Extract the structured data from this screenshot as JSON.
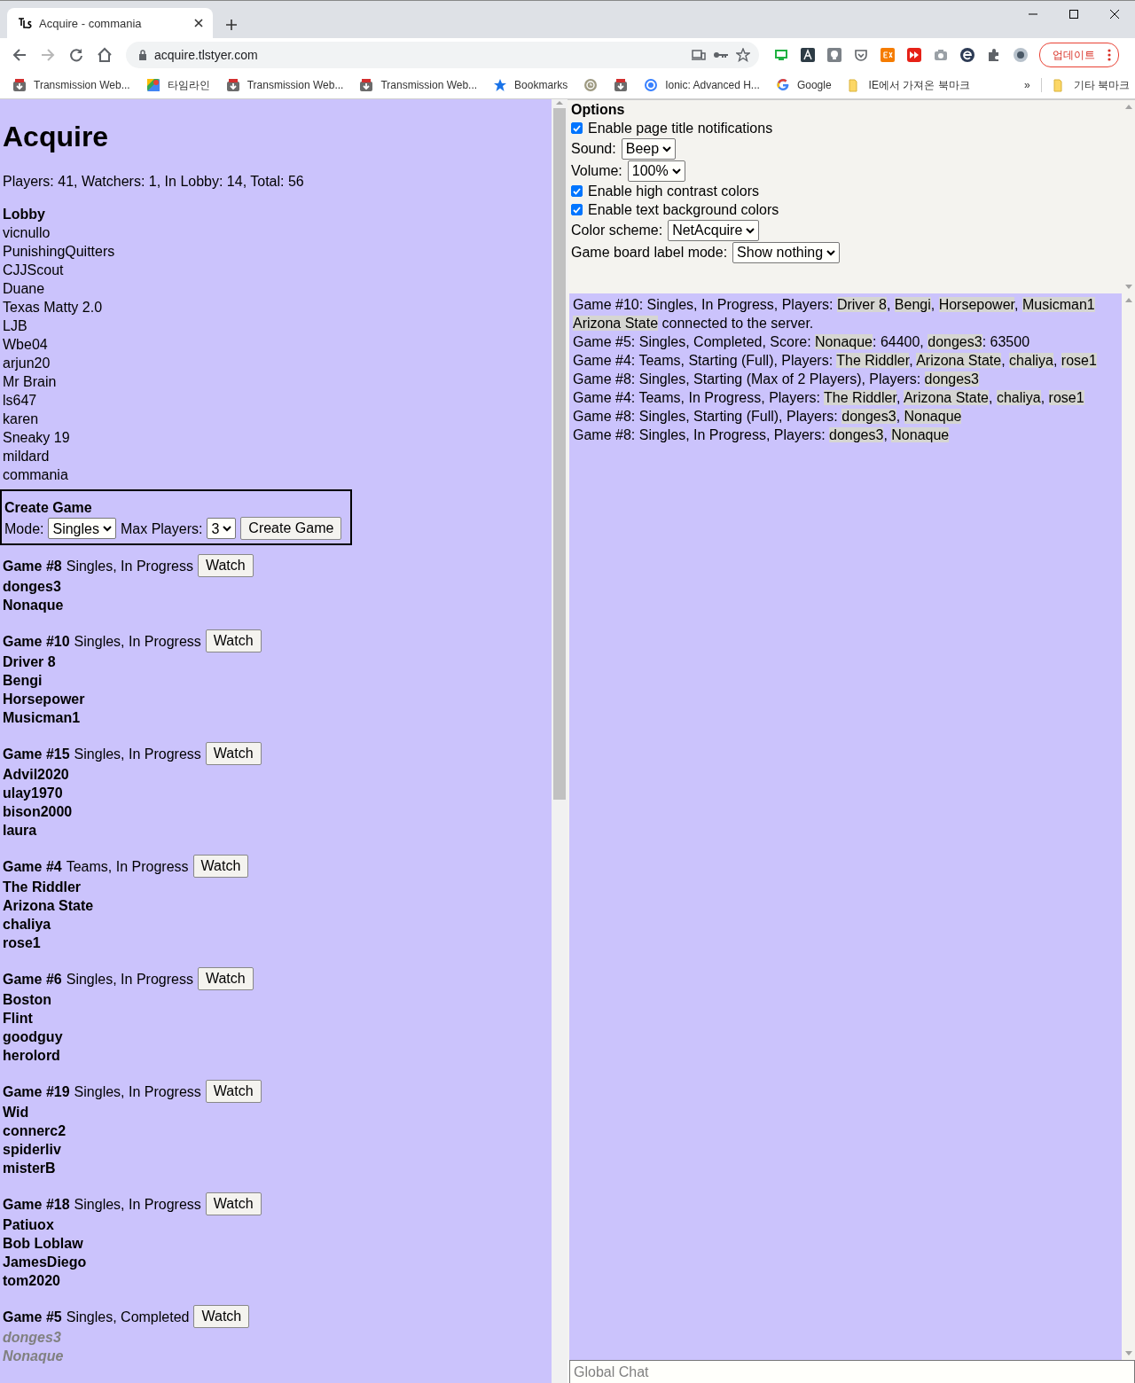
{
  "browser": {
    "tab": {
      "title": "Acquire - commania",
      "selected": true
    },
    "url": "acquire.tlstyer.com",
    "update_button": "업데이트",
    "bookmarks": [
      {
        "kind": "transmission",
        "label": "Transmission Web..."
      },
      {
        "kind": "maps",
        "label": "타임라인"
      },
      {
        "kind": "transmission",
        "label": "Transmission Web..."
      },
      {
        "kind": "transmission",
        "label": "Transmission Web..."
      },
      {
        "kind": "star",
        "label": "Bookmarks"
      },
      {
        "kind": "clock"
      },
      {
        "kind": "transmission"
      },
      {
        "kind": "ring",
        "label": "Ionic: Advanced H..."
      },
      {
        "kind": "google",
        "label": "Google"
      },
      {
        "kind": "folder",
        "label": "IE에서 가져온 북마크"
      }
    ],
    "more": "»",
    "other_bookmarks": "기타 북마크"
  },
  "lobby": {
    "title": "Acquire",
    "stats": "Players: 41, Watchers: 1, In Lobby: 14, Total: 56",
    "heading": "Lobby",
    "users": [
      "vicnullo",
      "PunishingQuitters",
      "CJJScout",
      "Duane",
      "Texas Matty 2.0",
      "LJB",
      "Wbe04",
      "arjun20",
      "Mr Brain",
      "ls647",
      "karen",
      "Sneaky 19",
      "mildard",
      "commania"
    ]
  },
  "create_game": {
    "heading": "Create Game",
    "mode_label": "Mode:",
    "mode": "Singles",
    "max_players_label": "Max Players:",
    "max_players": "3",
    "button": "Create Game"
  },
  "games": [
    {
      "title": "Game #8",
      "status": "Singles, In Progress",
      "button": "Watch",
      "completed": false,
      "players": [
        "donges3",
        "Nonaque"
      ]
    },
    {
      "title": "Game #10",
      "status": "Singles, In Progress",
      "button": "Watch",
      "completed": false,
      "players": [
        "Driver 8",
        "Bengi",
        "Horsepower",
        "Musicman1"
      ]
    },
    {
      "title": "Game #15",
      "status": "Singles, In Progress",
      "button": "Watch",
      "completed": false,
      "players": [
        "Advil2020",
        "ulay1970",
        "bison2000",
        "laura"
      ]
    },
    {
      "title": "Game #4",
      "status": "Teams, In Progress",
      "button": "Watch",
      "completed": false,
      "players": [
        "The Riddler",
        "Arizona State",
        "chaliya",
        "rose1"
      ]
    },
    {
      "title": "Game #6",
      "status": "Singles, In Progress",
      "button": "Watch",
      "completed": false,
      "players": [
        "Boston",
        "Flint",
        "goodguy",
        "herolord"
      ]
    },
    {
      "title": "Game #19",
      "status": "Singles, In Progress",
      "button": "Watch",
      "completed": false,
      "players": [
        "Wid",
        "connerc2",
        "spiderliv",
        "misterB"
      ]
    },
    {
      "title": "Game #18",
      "status": "Singles, In Progress",
      "button": "Watch",
      "completed": false,
      "players": [
        "Patiuox",
        "Bob Loblaw",
        "JamesDiego",
        "tom2020"
      ]
    },
    {
      "title": "Game #5",
      "status": "Singles, Completed",
      "button": "Watch",
      "completed": true,
      "players": [
        "donges3",
        "Nonaque"
      ]
    }
  ],
  "options": {
    "heading": "Options",
    "items": [
      {
        "kind": "checkbox",
        "label": "Enable page title notifications",
        "checked": true
      },
      {
        "kind": "select",
        "label": "Sound:",
        "value": "Beep"
      },
      {
        "kind": "select",
        "label": "Volume:",
        "value": "100%"
      },
      {
        "kind": "checkbox",
        "label": "Enable high contrast colors",
        "checked": true
      },
      {
        "kind": "checkbox",
        "label": "Enable text background colors",
        "checked": true
      },
      {
        "kind": "select",
        "label": "Color scheme:",
        "value": "NetAcquire"
      },
      {
        "kind": "select",
        "label": "Game board label mode:",
        "value": "Show nothing"
      }
    ]
  },
  "chat": {
    "placeholder": "Global Chat",
    "messages": [
      [
        {
          "lead": "Game #10: Singles, In Progress, Players: ",
          "name": "Driver 8",
          "trail": ", "
        },
        {
          "name": "Bengi",
          "trail": ", "
        },
        {
          "name": "Horsepower",
          "trail": ", "
        },
        {
          "name": "Musicman1"
        }
      ],
      [
        {
          "name": "Arizona State",
          "trail": " connected to the server."
        }
      ],
      [
        {
          "lead": "Game #5: Singles, Completed, Score: ",
          "name": "Nonaque",
          "trail": ": 64400, "
        },
        {
          "name": "donges3",
          "trail": ": 63500"
        }
      ],
      [
        {
          "lead": "Game #4: Teams, Starting (Full), Players: ",
          "name": "The Riddler",
          "trail": ", "
        },
        {
          "name": "Arizona State",
          "trail": ", "
        },
        {
          "name": "chaliya",
          "trail": ", "
        },
        {
          "name": "rose1"
        }
      ],
      [
        {
          "lead": "Game #8: Singles, Starting (Max of 2 Players), Players: ",
          "name": "donges3"
        }
      ],
      [
        {
          "lead": "Game #4: Teams, In Progress, Players: ",
          "name": "The Riddler",
          "trail": ", "
        },
        {
          "name": "Arizona State",
          "trail": ", "
        },
        {
          "name": "chaliya",
          "trail": ", "
        },
        {
          "name": "rose1"
        }
      ],
      [
        {
          "lead": "Game #8: Singles, Starting (Full), Players: ",
          "name": "donges3",
          "trail": ", "
        },
        {
          "name": "Nonaque"
        }
      ],
      [
        {
          "lead": "Game #8: Singles, In Progress, Players: ",
          "name": "donges3",
          "trail": ", "
        },
        {
          "name": "Nonaque"
        }
      ]
    ]
  }
}
